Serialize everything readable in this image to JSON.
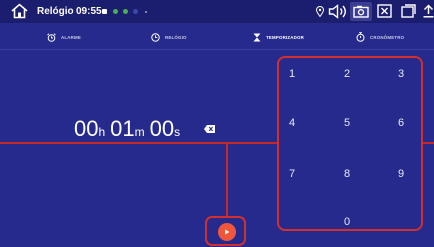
{
  "status_bar": {
    "app_title": "Relógio",
    "time": "09:55",
    "icons": [
      "home-icon",
      "location-icon",
      "volume-icon",
      "screenshot-icon",
      "close-box-icon",
      "window-icon",
      "upload-icon"
    ]
  },
  "tabs": [
    {
      "label": "ALARME",
      "icon": "alarm-icon",
      "active": false
    },
    {
      "label": "RELÓGIO",
      "icon": "clock-icon",
      "active": false
    },
    {
      "label": "TEMPORIZADOR",
      "icon": "hourglass-icon",
      "active": true
    },
    {
      "label": "CRONÔMETRO",
      "icon": "stopwatch-icon",
      "active": false
    }
  ],
  "timer": {
    "hours": "00",
    "hours_unit": "h",
    "minutes": "01",
    "minutes_unit": "m",
    "seconds": "00",
    "seconds_unit": "s"
  },
  "keypad": {
    "keys": [
      "1",
      "2",
      "3",
      "4",
      "5",
      "6",
      "7",
      "8",
      "9",
      "0"
    ]
  },
  "colors": {
    "background": "#262a8c",
    "status_bar": "#1b1d6e",
    "highlight_red": "#d32f2f",
    "play_button": "#f0563a"
  }
}
